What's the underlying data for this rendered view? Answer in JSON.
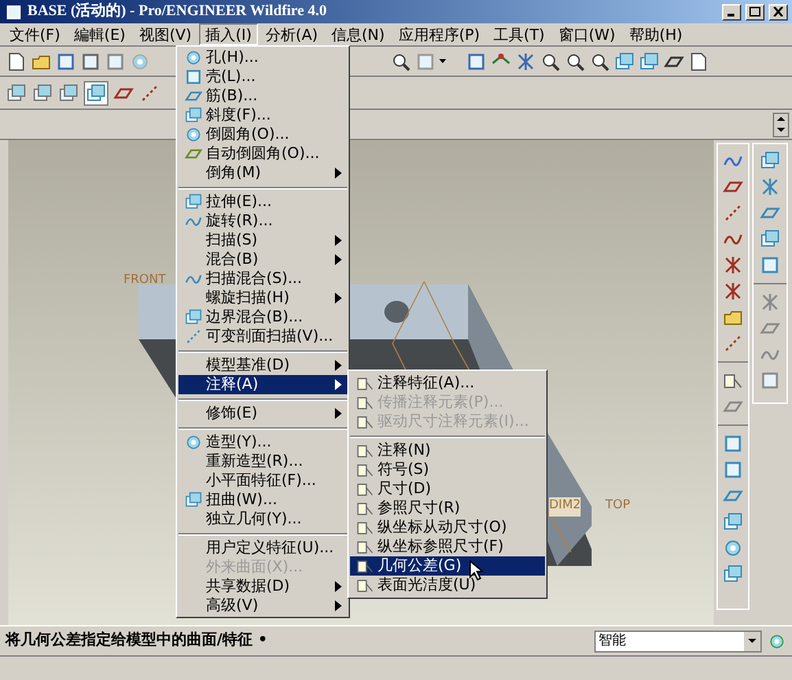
{
  "window": {
    "title": "BASE (活动的) - Pro/ENGINEER Wildfire 4.0"
  },
  "menubar": [
    {
      "label": "文件(F)",
      "selected": false
    },
    {
      "label": "編輯(E)",
      "selected": false
    },
    {
      "label": "视图(V)",
      "selected": false
    },
    {
      "label": "插入(I)",
      "selected": true
    },
    {
      "label": "分析(A)",
      "selected": false
    },
    {
      "label": "信息(N)",
      "selected": false
    },
    {
      "label": "应用程序(P)",
      "selected": false
    },
    {
      "label": "工具(T)",
      "selected": false
    },
    {
      "label": "窗口(W)",
      "selected": false
    },
    {
      "label": "帮助(H)",
      "selected": false
    }
  ],
  "insert_menu": [
    {
      "kind": "item",
      "label": "孔(H)...",
      "has_submenu": false,
      "disabled": false,
      "selected": false
    },
    {
      "kind": "item",
      "label": "壳(L)...",
      "has_submenu": false,
      "disabled": false,
      "selected": false
    },
    {
      "kind": "item",
      "label": "筋(B)...",
      "has_submenu": false,
      "disabled": false,
      "selected": false
    },
    {
      "kind": "item",
      "label": "斜度(F)...",
      "has_submenu": false,
      "disabled": false,
      "selected": false
    },
    {
      "kind": "item",
      "label": "倒圆角(O)...",
      "has_submenu": false,
      "disabled": false,
      "selected": false
    },
    {
      "kind": "item",
      "label": "自动倒圆角(O)...",
      "has_submenu": false,
      "disabled": false,
      "selected": false
    },
    {
      "kind": "item",
      "label": "倒角(M)",
      "has_submenu": true,
      "disabled": false,
      "selected": false
    },
    {
      "kind": "separator"
    },
    {
      "kind": "item",
      "label": "拉伸(E)...",
      "has_submenu": false,
      "disabled": false,
      "selected": false
    },
    {
      "kind": "item",
      "label": "旋转(R)...",
      "has_submenu": false,
      "disabled": false,
      "selected": false
    },
    {
      "kind": "item",
      "label": "扫描(S)",
      "has_submenu": true,
      "disabled": false,
      "selected": false
    },
    {
      "kind": "item",
      "label": "混合(B)",
      "has_submenu": true,
      "disabled": false,
      "selected": false
    },
    {
      "kind": "item",
      "label": "扫描混合(S)...",
      "has_submenu": false,
      "disabled": false,
      "selected": false
    },
    {
      "kind": "item",
      "label": "螺旋扫描(H)",
      "has_submenu": true,
      "disabled": false,
      "selected": false
    },
    {
      "kind": "item",
      "label": "边界混合(B)...",
      "has_submenu": false,
      "disabled": false,
      "selected": false
    },
    {
      "kind": "item",
      "label": "可变剖面扫描(V)...",
      "has_submenu": false,
      "disabled": false,
      "selected": false
    },
    {
      "kind": "separator"
    },
    {
      "kind": "item",
      "label": "模型基准(D)",
      "has_submenu": true,
      "disabled": false,
      "selected": false
    },
    {
      "kind": "item",
      "label": "注释(A)",
      "has_submenu": true,
      "disabled": false,
      "selected": true
    },
    {
      "kind": "separator"
    },
    {
      "kind": "item",
      "label": "修饰(E)",
      "has_submenu": true,
      "disabled": false,
      "selected": false
    },
    {
      "kind": "separator"
    },
    {
      "kind": "item",
      "label": "造型(Y)...",
      "has_submenu": false,
      "disabled": false,
      "selected": false
    },
    {
      "kind": "item",
      "label": "重新造型(R)...",
      "has_submenu": false,
      "disabled": false,
      "selected": false
    },
    {
      "kind": "item",
      "label": "小平面特征(F)...",
      "has_submenu": false,
      "disabled": false,
      "selected": false
    },
    {
      "kind": "item",
      "label": "扭曲(W)...",
      "has_submenu": false,
      "disabled": false,
      "selected": false
    },
    {
      "kind": "item",
      "label": "独立几何(Y)...",
      "has_submenu": false,
      "disabled": false,
      "selected": false
    },
    {
      "kind": "separator"
    },
    {
      "kind": "item",
      "label": "用户定义特征(U)...",
      "has_submenu": false,
      "disabled": false,
      "selected": false
    },
    {
      "kind": "item",
      "label": "外来曲面(X)...",
      "has_submenu": false,
      "disabled": true,
      "selected": false
    },
    {
      "kind": "item",
      "label": "共享数据(D)",
      "has_submenu": true,
      "disabled": false,
      "selected": false
    },
    {
      "kind": "item",
      "label": "高级(V)",
      "has_submenu": true,
      "disabled": false,
      "selected": false
    }
  ],
  "annotation_submenu": [
    {
      "kind": "item",
      "label": "注释特征(A)...",
      "disabled": false,
      "selected": false
    },
    {
      "kind": "item",
      "label": "传播注释元素(P)...",
      "disabled": true,
      "selected": false
    },
    {
      "kind": "item",
      "label": "驱动尺寸注释元素(I)...",
      "disabled": true,
      "selected": false
    },
    {
      "kind": "separator"
    },
    {
      "kind": "item",
      "label": "注释(N)",
      "disabled": false,
      "selected": false
    },
    {
      "kind": "item",
      "label": "符号(S)",
      "disabled": false,
      "selected": false
    },
    {
      "kind": "item",
      "label": "尺寸(D)",
      "disabled": false,
      "selected": false
    },
    {
      "kind": "item",
      "label": "参照尺寸(R)",
      "disabled": false,
      "selected": false
    },
    {
      "kind": "item",
      "label": "纵坐标从动尺寸(O)",
      "disabled": false,
      "selected": false
    },
    {
      "kind": "item",
      "label": "纵坐标参照尺寸(F)",
      "disabled": false,
      "selected": false
    },
    {
      "kind": "item",
      "label": "几何公差(G)",
      "disabled": false,
      "selected": true
    },
    {
      "kind": "item",
      "label": "表面光洁度(U)",
      "disabled": false,
      "selected": false
    }
  ],
  "viewport_labels": [
    "FRONT",
    "DIM2",
    "TOP"
  ],
  "status_bar": {
    "message": "将几何公差指定给模型中的曲面/特征 •",
    "filter": "智能"
  }
}
